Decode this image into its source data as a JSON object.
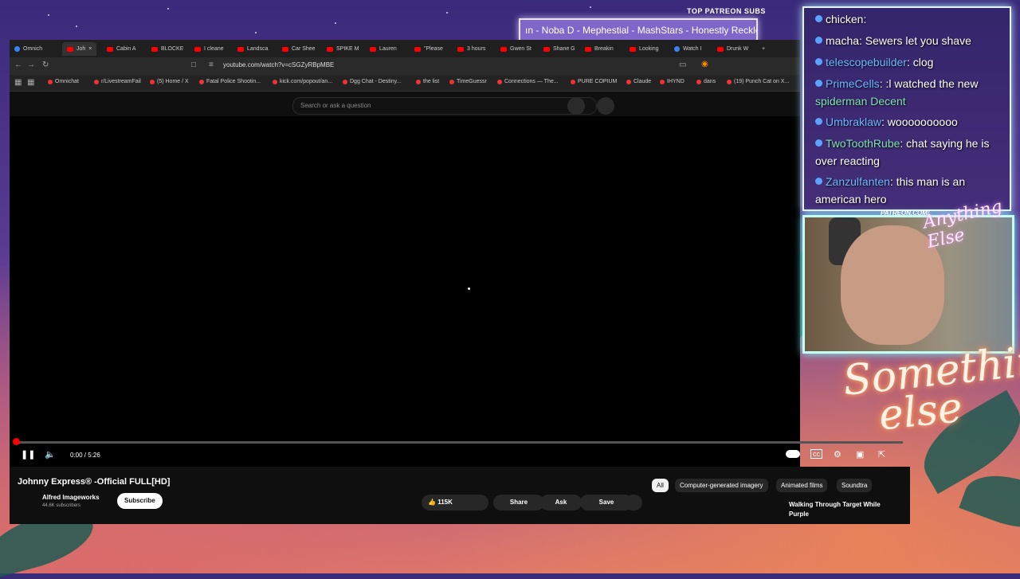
{
  "overlay": {
    "top_subs_label": "TOP PATREON SUBS",
    "ticker_text": "ın -  Noba D - Mephestial - MashStars - Honestly Reckless",
    "patreon_url": "PATREON.COM/",
    "patreon_script": "Anything Else",
    "logo_line1": "Something",
    "logo_line2": "else"
  },
  "browser": {
    "tabs": [
      {
        "label": "Omnich",
        "fav": "g"
      },
      {
        "label": "Joh",
        "fav": "r",
        "active": true
      },
      {
        "label": "Cabin A",
        "fav": "r"
      },
      {
        "label": "BLOCKE",
        "fav": "r"
      },
      {
        "label": "I cleane",
        "fav": "r"
      },
      {
        "label": "Landsca",
        "fav": "r"
      },
      {
        "label": "Car Shee",
        "fav": "r"
      },
      {
        "label": "SPIKE M",
        "fav": "r"
      },
      {
        "label": "Lauren",
        "fav": "r"
      },
      {
        "label": "\"Please",
        "fav": "r"
      },
      {
        "label": "3 hours",
        "fav": "r"
      },
      {
        "label": "Gwen St",
        "fav": "r"
      },
      {
        "label": "Shane G",
        "fav": "r"
      },
      {
        "label": "Breakin",
        "fav": "r"
      },
      {
        "label": "Looking",
        "fav": "r"
      },
      {
        "label": "Watch I",
        "fav": "g"
      },
      {
        "label": "Drunk W",
        "fav": "r"
      }
    ],
    "new_tab": "+",
    "url": "youtube.com/watch?v=cSGZyRBpMBE",
    "bookmarks": [
      "Omnichat",
      "r/LivestreamFail",
      "(5) Home / X",
      "Fatal Police Shootin...",
      "kick.com/popout/an...",
      "Dgg Chat - Destiny...",
      "the list",
      "TimeGuessr",
      "Connections — The...",
      "PURE COPIUM",
      "Claude",
      "IHYND",
      "dans",
      "(19) Punch Cat on X..."
    ]
  },
  "youtube": {
    "search_placeholder": "Search or ask a question",
    "time": "0:00 / 5:26",
    "progress_fraction": 0.0,
    "title": "Johnny Express® -Official FULL[HD]",
    "channel": "Alfred Imageworks",
    "subscribers": "44.6K subscribers",
    "subscribe": "Subscribe",
    "likes": "115K",
    "share": "Share",
    "ask": "Ask",
    "save": "Save",
    "chips": [
      "All",
      "Computer-generated imagery",
      "Animated films",
      "Soundtra"
    ],
    "recommendation_title": "Walking Through Target While Purple"
  },
  "chat": [
    {
      "user": "chicken",
      "color": "w",
      "text": ":"
    },
    {
      "user": "macha",
      "color": "w",
      "text": ": Sewers let you shave"
    },
    {
      "user": "telescopebuilder",
      "color": "b",
      "text": ":     clog"
    },
    {
      "user": "PrimeCells",
      "color": "b",
      "text": ": :l watched the new"
    },
    {
      "user": "",
      "color": "g",
      "text": "spiderman       Decent"
    },
    {
      "user": "Umbraklaw",
      "color": "b",
      "text": ": woooooooooo"
    },
    {
      "user": "TwoToothRube",
      "color": "g",
      "text": ": chat saying he is"
    },
    {
      "user": "",
      "color": "w",
      "text": "over reacting"
    },
    {
      "user": "Zanzulfanten",
      "color": "b",
      "text": ": this man is an"
    },
    {
      "user": "",
      "color": "w",
      "text": "american hero"
    }
  ]
}
